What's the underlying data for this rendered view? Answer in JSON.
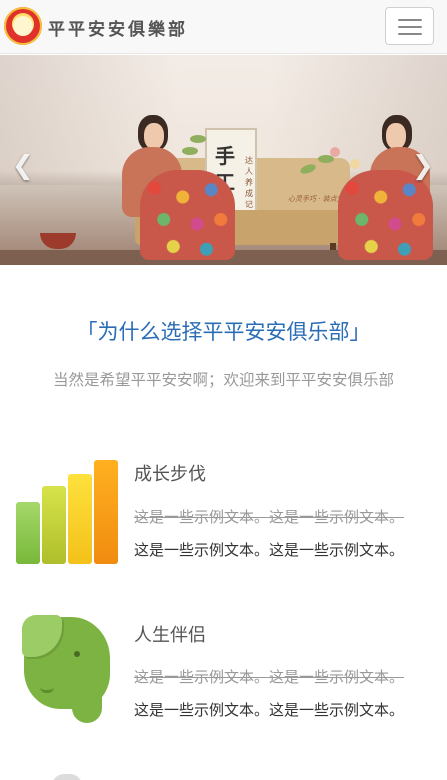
{
  "navbar": {
    "brand": "平平安安俱樂部",
    "logo_icon": "club-logo-icon",
    "menu_icon": "hamburger-menu-icon"
  },
  "carousel": {
    "frame_text": "手工",
    "frame_side_text": "达人养成记",
    "caption": "心灵手巧 · 装点生活",
    "prev_icon": "chevron-left-icon",
    "next_icon": "chevron-right-icon",
    "slide_count": 2,
    "active_slide": 1
  },
  "section": {
    "title": "「为什么选择平平安安俱乐部」",
    "subtitle": "当然是希望平平安安啊；欢迎来到平平安安俱乐部"
  },
  "features": [
    {
      "icon": "bar-chart-icon",
      "title": "成长步伐",
      "strike_text": "这是一些示例文本。这是一些示例文本。",
      "text": "这是一些示例文本。这是一些示例文本。"
    },
    {
      "icon": "evernote-elephant-icon",
      "title": "人生伴侣",
      "strike_text": "这是一些示例文本。这是一些示例文本。",
      "text": "这是一些示例文本。这是一些示例文本。"
    }
  ],
  "colors": {
    "title_blue": "#2a6db5",
    "subtitle_gray": "#999999",
    "elephant_green": "#7cb342"
  }
}
